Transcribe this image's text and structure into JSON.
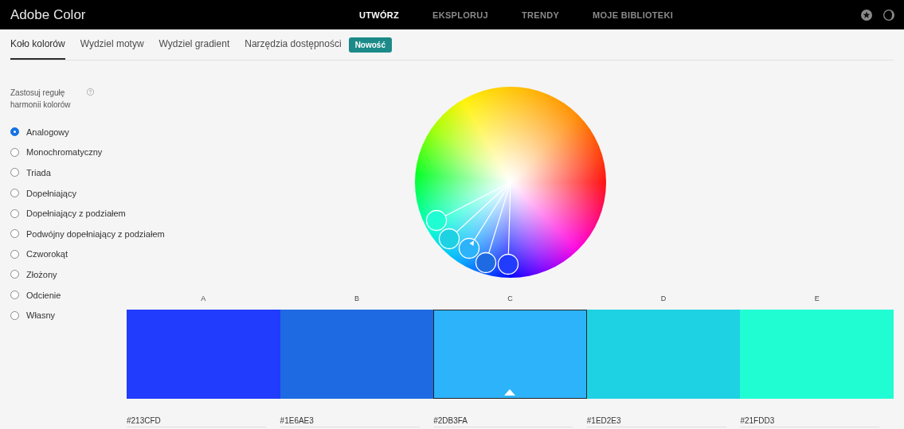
{
  "header": {
    "logo": "Adobe Color",
    "nav": [
      {
        "label": "UTWÓRZ",
        "selected": true
      },
      {
        "label": "EKSPLORUJ",
        "selected": false
      },
      {
        "label": "TRENDY",
        "selected": false
      },
      {
        "label": "MOJE BIBLIOTEKI",
        "selected": false
      }
    ]
  },
  "tabs": [
    {
      "label": "Koło kolorów",
      "selected": true
    },
    {
      "label": "Wydziel motyw",
      "selected": false
    },
    {
      "label": "Wydziel gradient",
      "selected": false
    },
    {
      "label": "Narzędzia dostępności",
      "selected": false
    }
  ],
  "badge": "Nowość",
  "harmony": {
    "title": "Zastosuj regułę harmonii kolorów",
    "options": [
      {
        "label": "Analogowy",
        "selected": true
      },
      {
        "label": "Monochromatyczny",
        "selected": false
      },
      {
        "label": "Triada",
        "selected": false
      },
      {
        "label": "Dopełniający",
        "selected": false
      },
      {
        "label": "Dopełniający z podziałem",
        "selected": false
      },
      {
        "label": "Podwójny dopełniający z podziałem",
        "selected": false
      },
      {
        "label": "Czworokąt",
        "selected": false
      },
      {
        "label": "Złożony",
        "selected": false
      },
      {
        "label": "Odcienie",
        "selected": false
      },
      {
        "label": "Własny",
        "selected": false
      }
    ]
  },
  "swatches": [
    {
      "label": "A",
      "hex": "#213CFD",
      "color": "#213cfd",
      "selected": false
    },
    {
      "label": "B",
      "hex": "#1E6AE3",
      "color": "#1e6ae3",
      "selected": false
    },
    {
      "label": "C",
      "hex": "#2DB3FA",
      "color": "#2db3fa",
      "selected": true
    },
    {
      "label": "D",
      "hex": "#1ED2E3",
      "color": "#1ed2e3",
      "selected": false
    },
    {
      "label": "E",
      "hex": "#21FDD3",
      "color": "#21fdd3",
      "selected": false
    }
  ]
}
